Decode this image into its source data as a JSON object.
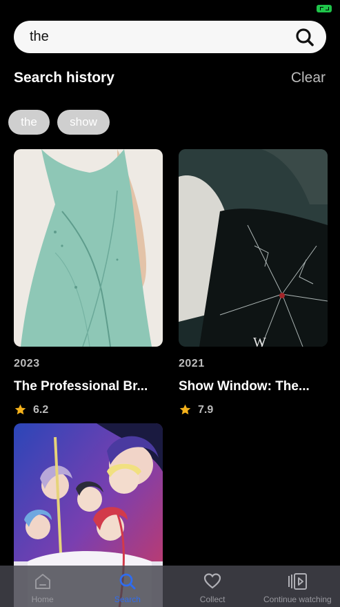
{
  "search": {
    "value": "the"
  },
  "history": {
    "title": "Search history",
    "clear_label": "Clear",
    "chips": [
      "the",
      "show"
    ]
  },
  "results": [
    {
      "year": "2023",
      "title": "The Professional Br...",
      "rating": "6.2"
    },
    {
      "year": "2021",
      "title": "Show Window: The...",
      "rating": "7.9"
    },
    {
      "year": "",
      "title": "",
      "rating": ""
    }
  ],
  "tabs": [
    {
      "label": "Home",
      "icon": "home-icon"
    },
    {
      "label": "Search",
      "icon": "search-icon",
      "active": true
    },
    {
      "label": "Collect",
      "icon": "heart-icon"
    },
    {
      "label": "Continue watching",
      "icon": "play-library-icon"
    }
  ],
  "colors": {
    "accent": "#2f6cf0",
    "star": "#f5b21b",
    "status": "#1fc44a"
  }
}
